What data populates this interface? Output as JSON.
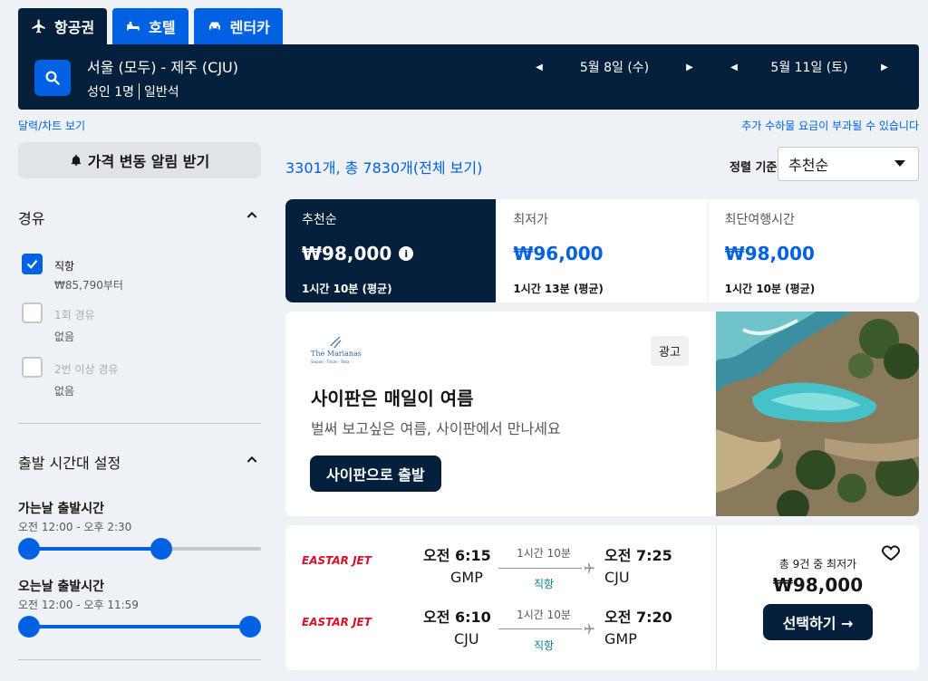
{
  "tabs": [
    {
      "label": "항공권",
      "icon": "plane-icon",
      "active": true
    },
    {
      "label": "호텔",
      "icon": "bed-icon",
      "active": false
    },
    {
      "label": "렌터카",
      "icon": "car-icon",
      "active": false
    }
  ],
  "search": {
    "route": "서울 (모두) - 제주 (CJU)",
    "travellers": "성인 1명",
    "cabin": "일반석",
    "depart_date": "5월 8일 (수)",
    "return_date": "5월 11일 (토)"
  },
  "links": {
    "calendar": "달력/차트 보기",
    "baggage_notice": "추가 수하물 요금이 부과될 수 있습니다"
  },
  "sidebar": {
    "price_alert": "가격 변동 알림 받기",
    "stops_title": "경유",
    "stops": [
      {
        "label": "직항",
        "sub": "₩85,790부터",
        "checked": true,
        "disabled": false
      },
      {
        "label": "1회 경유",
        "sub": "없음",
        "checked": false,
        "disabled": true
      },
      {
        "label": "2번 이상 경유",
        "sub": "없음",
        "checked": false,
        "disabled": true
      }
    ],
    "time_title": "출발 시간대 설정",
    "outbound": {
      "label": "가는날 출발시간",
      "range": "오전 12:00 - 오후 2:30",
      "fill_start": 0,
      "fill_end": 0.6
    },
    "inbound": {
      "label": "오는날 출발시간",
      "range": "오전 12:00 - 오후 11:59",
      "fill_start": 0,
      "fill_end": 1
    }
  },
  "results": {
    "count": "3301개, 총 7830개(전체 보기)",
    "sort_label": "정렬 기준",
    "sort_value": "추천순"
  },
  "sort_tabs": [
    {
      "title": "추천순",
      "price": "₩98,000",
      "duration": "1시간 10분 (평균)",
      "active": true
    },
    {
      "title": "최저가",
      "price": "₩96,000",
      "duration": "1시간 13분 (평균)",
      "active": false
    },
    {
      "title": "최단여행시간",
      "price": "₩98,000",
      "duration": "1시간 10분 (평균)",
      "active": false
    }
  ],
  "ad": {
    "brand": "The Marianas",
    "brand_tagline": "Saipan · Tinian · Rota",
    "badge": "광고",
    "title": "사이판은 매일이 여름",
    "subtitle": "벌써 보고싶은 여름, 사이판에서 만나세요",
    "cta": "사이판으로 출발"
  },
  "flight": {
    "airline": "EASTAR JET",
    "legs": [
      {
        "dep_time": "오전 6:15",
        "dep_code": "GMP",
        "duration": "1시간 10분",
        "stops": "직항",
        "arr_time": "오전 7:25",
        "arr_code": "CJU"
      },
      {
        "dep_time": "오전 6:10",
        "dep_code": "CJU",
        "duration": "1시간 10분",
        "stops": "직항",
        "arr_time": "오전 7:20",
        "arr_code": "GMP"
      }
    ],
    "deals": "총 9건 중 최저가",
    "price": "₩98,000",
    "select": "선택하기 →"
  },
  "colors": {
    "navy": "#05203c",
    "blue": "#0062e3",
    "teal": "#0c838a",
    "airline_red": "#d7122a"
  }
}
